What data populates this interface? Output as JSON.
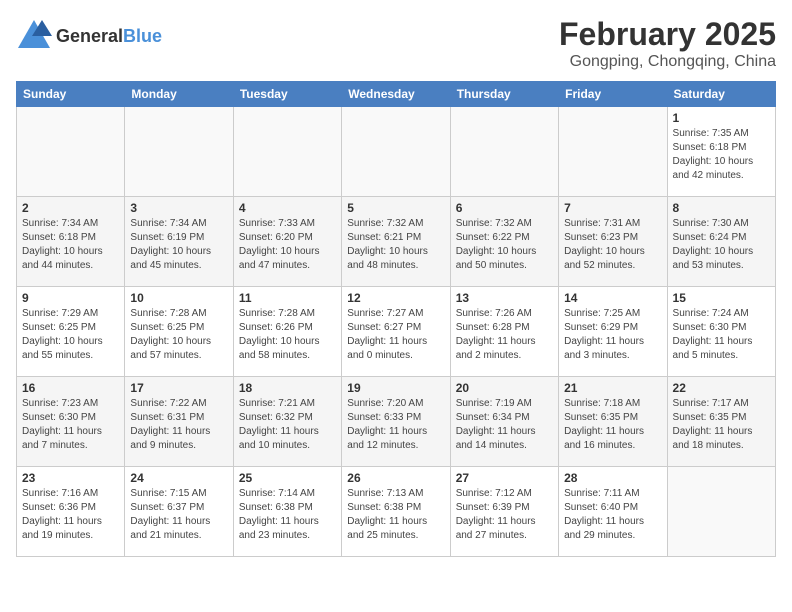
{
  "header": {
    "logo": {
      "general": "General",
      "blue": "Blue"
    },
    "title": "February 2025",
    "location": "Gongping, Chongqing, China"
  },
  "calendar": {
    "days_of_week": [
      "Sunday",
      "Monday",
      "Tuesday",
      "Wednesday",
      "Thursday",
      "Friday",
      "Saturday"
    ],
    "weeks": [
      [
        {
          "day": "",
          "info": ""
        },
        {
          "day": "",
          "info": ""
        },
        {
          "day": "",
          "info": ""
        },
        {
          "day": "",
          "info": ""
        },
        {
          "day": "",
          "info": ""
        },
        {
          "day": "",
          "info": ""
        },
        {
          "day": "1",
          "info": "Sunrise: 7:35 AM\nSunset: 6:18 PM\nDaylight: 10 hours and 42 minutes."
        }
      ],
      [
        {
          "day": "2",
          "info": "Sunrise: 7:34 AM\nSunset: 6:18 PM\nDaylight: 10 hours and 44 minutes."
        },
        {
          "day": "3",
          "info": "Sunrise: 7:34 AM\nSunset: 6:19 PM\nDaylight: 10 hours and 45 minutes."
        },
        {
          "day": "4",
          "info": "Sunrise: 7:33 AM\nSunset: 6:20 PM\nDaylight: 10 hours and 47 minutes."
        },
        {
          "day": "5",
          "info": "Sunrise: 7:32 AM\nSunset: 6:21 PM\nDaylight: 10 hours and 48 minutes."
        },
        {
          "day": "6",
          "info": "Sunrise: 7:32 AM\nSunset: 6:22 PM\nDaylight: 10 hours and 50 minutes."
        },
        {
          "day": "7",
          "info": "Sunrise: 7:31 AM\nSunset: 6:23 PM\nDaylight: 10 hours and 52 minutes."
        },
        {
          "day": "8",
          "info": "Sunrise: 7:30 AM\nSunset: 6:24 PM\nDaylight: 10 hours and 53 minutes."
        }
      ],
      [
        {
          "day": "9",
          "info": "Sunrise: 7:29 AM\nSunset: 6:25 PM\nDaylight: 10 hours and 55 minutes."
        },
        {
          "day": "10",
          "info": "Sunrise: 7:28 AM\nSunset: 6:25 PM\nDaylight: 10 hours and 57 minutes."
        },
        {
          "day": "11",
          "info": "Sunrise: 7:28 AM\nSunset: 6:26 PM\nDaylight: 10 hours and 58 minutes."
        },
        {
          "day": "12",
          "info": "Sunrise: 7:27 AM\nSunset: 6:27 PM\nDaylight: 11 hours and 0 minutes."
        },
        {
          "day": "13",
          "info": "Sunrise: 7:26 AM\nSunset: 6:28 PM\nDaylight: 11 hours and 2 minutes."
        },
        {
          "day": "14",
          "info": "Sunrise: 7:25 AM\nSunset: 6:29 PM\nDaylight: 11 hours and 3 minutes."
        },
        {
          "day": "15",
          "info": "Sunrise: 7:24 AM\nSunset: 6:30 PM\nDaylight: 11 hours and 5 minutes."
        }
      ],
      [
        {
          "day": "16",
          "info": "Sunrise: 7:23 AM\nSunset: 6:30 PM\nDaylight: 11 hours and 7 minutes."
        },
        {
          "day": "17",
          "info": "Sunrise: 7:22 AM\nSunset: 6:31 PM\nDaylight: 11 hours and 9 minutes."
        },
        {
          "day": "18",
          "info": "Sunrise: 7:21 AM\nSunset: 6:32 PM\nDaylight: 11 hours and 10 minutes."
        },
        {
          "day": "19",
          "info": "Sunrise: 7:20 AM\nSunset: 6:33 PM\nDaylight: 11 hours and 12 minutes."
        },
        {
          "day": "20",
          "info": "Sunrise: 7:19 AM\nSunset: 6:34 PM\nDaylight: 11 hours and 14 minutes."
        },
        {
          "day": "21",
          "info": "Sunrise: 7:18 AM\nSunset: 6:35 PM\nDaylight: 11 hours and 16 minutes."
        },
        {
          "day": "22",
          "info": "Sunrise: 7:17 AM\nSunset: 6:35 PM\nDaylight: 11 hours and 18 minutes."
        }
      ],
      [
        {
          "day": "23",
          "info": "Sunrise: 7:16 AM\nSunset: 6:36 PM\nDaylight: 11 hours and 19 minutes."
        },
        {
          "day": "24",
          "info": "Sunrise: 7:15 AM\nSunset: 6:37 PM\nDaylight: 11 hours and 21 minutes."
        },
        {
          "day": "25",
          "info": "Sunrise: 7:14 AM\nSunset: 6:38 PM\nDaylight: 11 hours and 23 minutes."
        },
        {
          "day": "26",
          "info": "Sunrise: 7:13 AM\nSunset: 6:38 PM\nDaylight: 11 hours and 25 minutes."
        },
        {
          "day": "27",
          "info": "Sunrise: 7:12 AM\nSunset: 6:39 PM\nDaylight: 11 hours and 27 minutes."
        },
        {
          "day": "28",
          "info": "Sunrise: 7:11 AM\nSunset: 6:40 PM\nDaylight: 11 hours and 29 minutes."
        },
        {
          "day": "",
          "info": ""
        }
      ]
    ]
  }
}
